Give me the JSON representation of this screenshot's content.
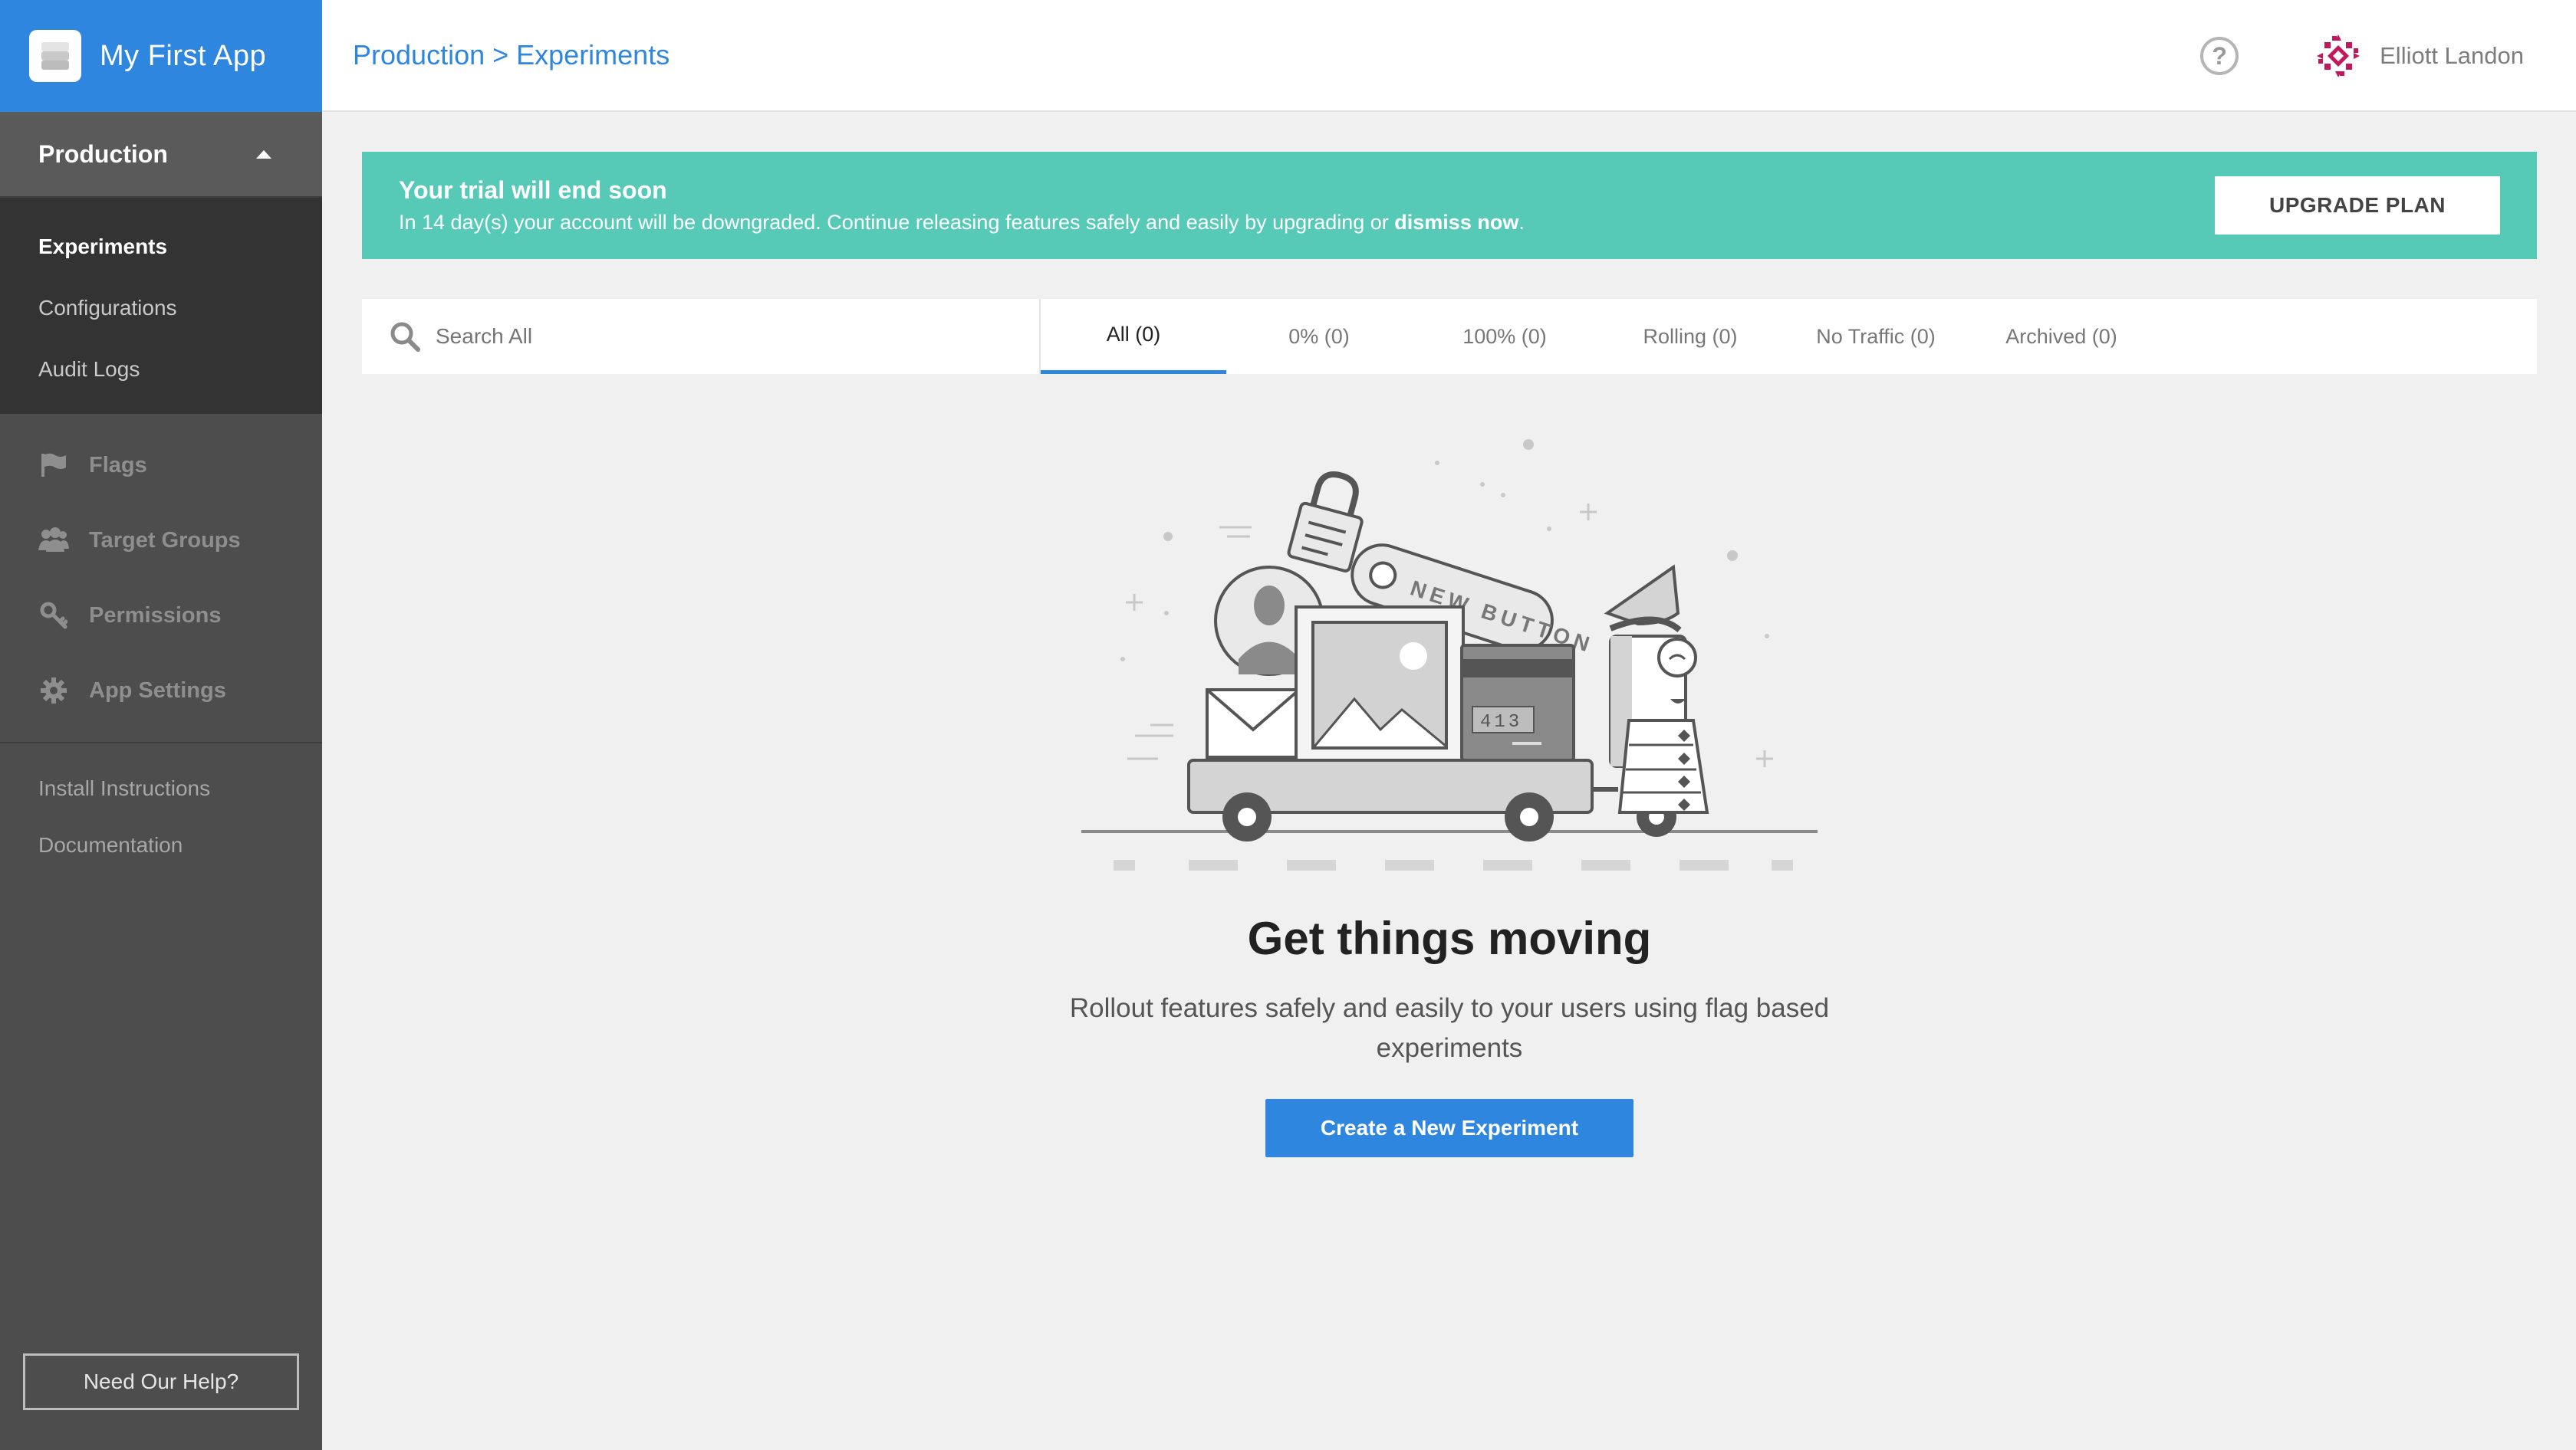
{
  "app": {
    "name": "My First App"
  },
  "sidebar": {
    "environment": "Production",
    "env_items": [
      {
        "label": "Experiments",
        "active": true
      },
      {
        "label": "Configurations"
      },
      {
        "label": "Audit Logs"
      }
    ],
    "main_items": [
      {
        "label": "Flags",
        "icon": "flag-icon"
      },
      {
        "label": "Target Groups",
        "icon": "users-icon"
      },
      {
        "label": "Permissions",
        "icon": "key-icon"
      },
      {
        "label": "App Settings",
        "icon": "gear-icon"
      }
    ],
    "links": [
      {
        "label": "Install Instructions"
      },
      {
        "label": "Documentation"
      }
    ],
    "help_button": "Need Our Help?"
  },
  "header": {
    "breadcrumb": "Production > Experiments",
    "help_icon": "?",
    "user": {
      "name": "Elliott Landon"
    }
  },
  "banner": {
    "title": "Your trial will end soon",
    "text": "In 14 day(s) your account will be downgraded. Continue releasing features safely and easily by upgrading or ",
    "dismiss": "dismiss now",
    "text_end": ".",
    "upgrade_button": "UPGRADE PLAN",
    "color": "#56cab6"
  },
  "filters": {
    "search_placeholder": "Search All",
    "tabs": [
      {
        "label": "All (0)",
        "active": true
      },
      {
        "label": "0% (0)"
      },
      {
        "label": "100% (0)"
      },
      {
        "label": "Rolling (0)"
      },
      {
        "label": "No Traffic (0)"
      },
      {
        "label": "Archived (0)"
      }
    ]
  },
  "empty_state": {
    "title": "Get things moving",
    "text": "Rollout features safely and easily to your users using flag based experiments",
    "button": "Create a New Experiment",
    "illustration": {
      "tag_text": "NEW BUTTON",
      "card_number": "413"
    }
  },
  "colors": {
    "accent": "#2f86df",
    "sidebar": "#4d4d4d"
  }
}
